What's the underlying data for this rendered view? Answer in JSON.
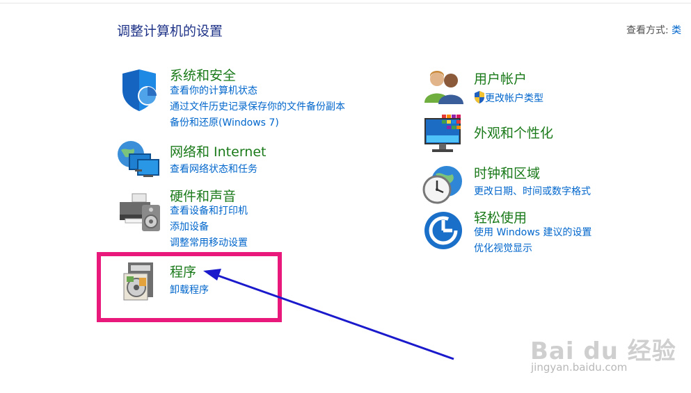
{
  "header": {
    "title": "调整计算机的设置",
    "view_by_label": "查看方式:",
    "view_by_value": "类"
  },
  "left_categories": [
    {
      "title": "系统和安全",
      "icon": "shield-icon",
      "links": [
        "查看你的计算机状态",
        "通过文件历史记录保存你的文件备份副本",
        "备份和还原(Windows 7)"
      ]
    },
    {
      "title": "网络和 Internet",
      "icon": "network-icon",
      "links": [
        "查看网络状态和任务"
      ]
    },
    {
      "title": "硬件和声音",
      "icon": "printer-icon",
      "links": [
        "查看设备和打印机",
        "添加设备",
        "调整常用移动设置"
      ]
    },
    {
      "title": "程序",
      "icon": "programs-icon",
      "links": [
        "卸载程序"
      ]
    }
  ],
  "right_categories": [
    {
      "title": "用户帐户",
      "icon": "users-icon",
      "links": [
        "更改帐户类型"
      ]
    },
    {
      "title": "外观和个性化",
      "icon": "appearance-icon",
      "links": []
    },
    {
      "title": "时钟和区域",
      "icon": "clock-globe-icon",
      "links": [
        "更改日期、时间或数字格式"
      ]
    },
    {
      "title": "轻松使用",
      "icon": "ease-of-access-icon",
      "links": [
        "使用 Windows 建议的设置",
        "优化视觉显示"
      ]
    }
  ],
  "annotation": {
    "highlight_color": "#e8197a",
    "arrow_color": "#1a1acc"
  },
  "watermark": {
    "brand": "Bai du 经验",
    "url": "jingyan.baidu.com"
  },
  "colors": {
    "title_blue": "#1e3287",
    "category_green": "#1a7a1a",
    "link_blue": "#0066cc"
  }
}
